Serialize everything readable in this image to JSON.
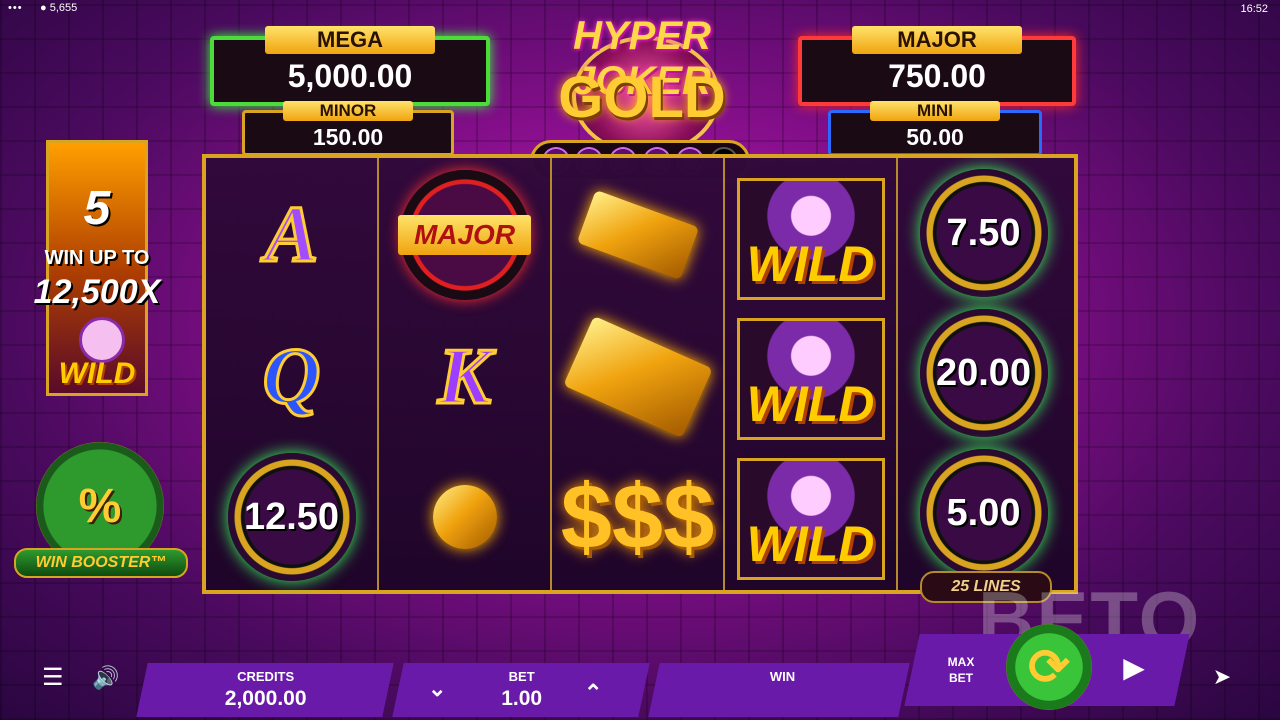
{
  "status_bar": {
    "menu_dots": "•••",
    "balance": "5,655",
    "clock": "16:52"
  },
  "logo": {
    "line1": "HYPER JOKER",
    "line2": "GOLD"
  },
  "jackpots": {
    "mega": {
      "label": "MEGA",
      "value": "5,000.00"
    },
    "minor": {
      "label": "MINOR",
      "value": "150.00"
    },
    "major": {
      "label": "MAJOR",
      "value": "750.00"
    },
    "mini": {
      "label": "MINI",
      "value": "50.00"
    }
  },
  "collected_chips": {
    "filled": 5,
    "total": 6
  },
  "side_panel": {
    "count": "5",
    "text1": "WIN UP TO",
    "text2": "12,500X",
    "wild": "WILD"
  },
  "reels": {
    "r1": [
      "A",
      "Q",
      "12.50"
    ],
    "r2": [
      "MAJOR",
      "K",
      "coins"
    ],
    "r3": [
      "gold-bar",
      "gold-bars",
      "dollars"
    ],
    "r4": [
      "WILD",
      "WILD",
      "WILD"
    ],
    "r5": [
      "7.50",
      "20.00",
      "5.00"
    ]
  },
  "dollar_symbol": "$$$",
  "lines_label": "25 LINES",
  "win_booster": {
    "icon": "%",
    "label": "WIN BOOSTER™"
  },
  "bottom": {
    "credits_label": "CREDITS",
    "credits_value": "2,000.00",
    "bet_label": "BET",
    "bet_value": "1.00",
    "win_label": "WIN",
    "win_value": "",
    "max_bet_label": "MAX BET"
  },
  "watermark": "BETO",
  "colors": {
    "accent_purple": "#6a1aa8",
    "gold": "#d9a520",
    "spin_green": "#39c43a"
  }
}
